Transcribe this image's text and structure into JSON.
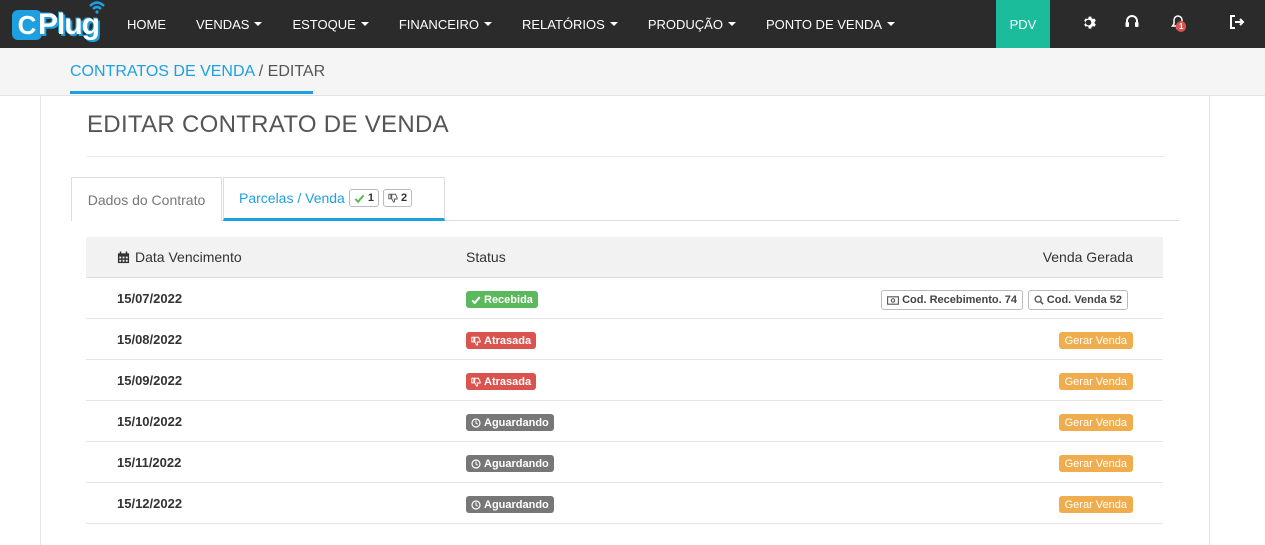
{
  "app": {
    "logo_text": "Plug",
    "logo_initial": "C"
  },
  "nav": {
    "items": [
      {
        "label": "HOME",
        "dropdown": false
      },
      {
        "label": "VENDAS",
        "dropdown": true
      },
      {
        "label": "ESTOQUE",
        "dropdown": true
      },
      {
        "label": "FINANCEIRO",
        "dropdown": true
      },
      {
        "label": "RELATÓRIOS",
        "dropdown": true
      },
      {
        "label": "PRODUÇÃO",
        "dropdown": true
      },
      {
        "label": "PONTO DE VENDA",
        "dropdown": true
      }
    ],
    "pdv_label": "PDV",
    "notification_count": "1",
    "icons": [
      "gear-icon",
      "headset-icon",
      "bell-icon",
      "logout-icon"
    ]
  },
  "breadcrumb": {
    "parent": "CONTRATOS DE VENDA",
    "separator": " / ",
    "current": "EDITAR"
  },
  "page": {
    "title": "EDITAR CONTRATO DE VENDA"
  },
  "tabs": {
    "dados": "Dados do Contrato",
    "parcelas": "Parcelas / Venda",
    "received_count": "1",
    "overdue_count": "2"
  },
  "table": {
    "headers": {
      "date": "Data Vencimento",
      "status": "Status",
      "venda": "Venda Gerada"
    },
    "rows": [
      {
        "date": "15/07/2022",
        "status": "Recebida",
        "status_kind": "received",
        "receipt": "Cod. Recebimento. 74",
        "sale": "Cod. Venda 52"
      },
      {
        "date": "15/08/2022",
        "status": "Atrasada",
        "status_kind": "overdue",
        "action": "Gerar Venda"
      },
      {
        "date": "15/09/2022",
        "status": "Atrasada",
        "status_kind": "overdue",
        "action": "Gerar Venda"
      },
      {
        "date": "15/10/2022",
        "status": "Aguardando",
        "status_kind": "waiting",
        "action": "Gerar Venda"
      },
      {
        "date": "15/11/2022",
        "status": "Aguardando",
        "status_kind": "waiting",
        "action": "Gerar Venda"
      },
      {
        "date": "15/12/2022",
        "status": "Aguardando",
        "status_kind": "waiting",
        "action": "Gerar Venda"
      }
    ]
  },
  "colors": {
    "nav_bg": "#2b2b2b",
    "accent": "#1ea0e0",
    "pdv": "#1abc9c",
    "received": "#5cb85c",
    "overdue": "#d9534f",
    "waiting": "#777777",
    "action": "#f0ad4e"
  }
}
